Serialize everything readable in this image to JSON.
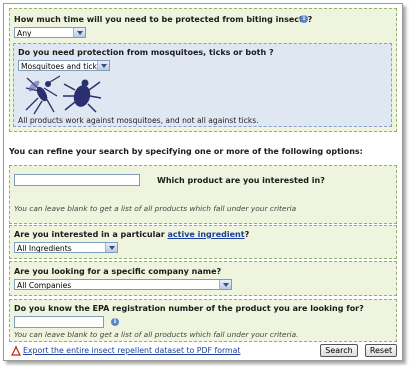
{
  "q_time": {
    "label": "How much time will you need to be protected from biting insects?",
    "selected": "Any"
  },
  "q_protection": {
    "label": "Do you need protection from mosquitoes, ticks or both ?",
    "selected": "Mosquitoes and ticks",
    "note": "All products work against mosquitoes, and not all against ticks."
  },
  "refine_text": "You can refine your search by specifying one or more of the following options:",
  "q_product": {
    "label": "Which product are you interested in?",
    "value": "",
    "note": "You can leave blank to get a list of all products which fall under your criteria"
  },
  "q_ingredient": {
    "label_before": "Are you interested in a particular",
    "label_link": "active ingredient",
    "label_after": "?",
    "selected": "All Ingredients"
  },
  "q_company": {
    "label": "Are you looking for a specific company name?",
    "selected": "All Companies"
  },
  "q_epa": {
    "label": "Do you know the EPA registration number of the product you are looking for?",
    "value": "",
    "note": "You can leave blank to get a list of all products which fall under your criteria."
  },
  "export_link": "Export the entire insect repellent dataset to PDF format",
  "buttons": {
    "search": "Search",
    "reset": "Reset"
  },
  "colors": {
    "panel_green": "#eef4dd",
    "panel_blue": "#dfe7f3",
    "link": "#1a3f9c"
  }
}
